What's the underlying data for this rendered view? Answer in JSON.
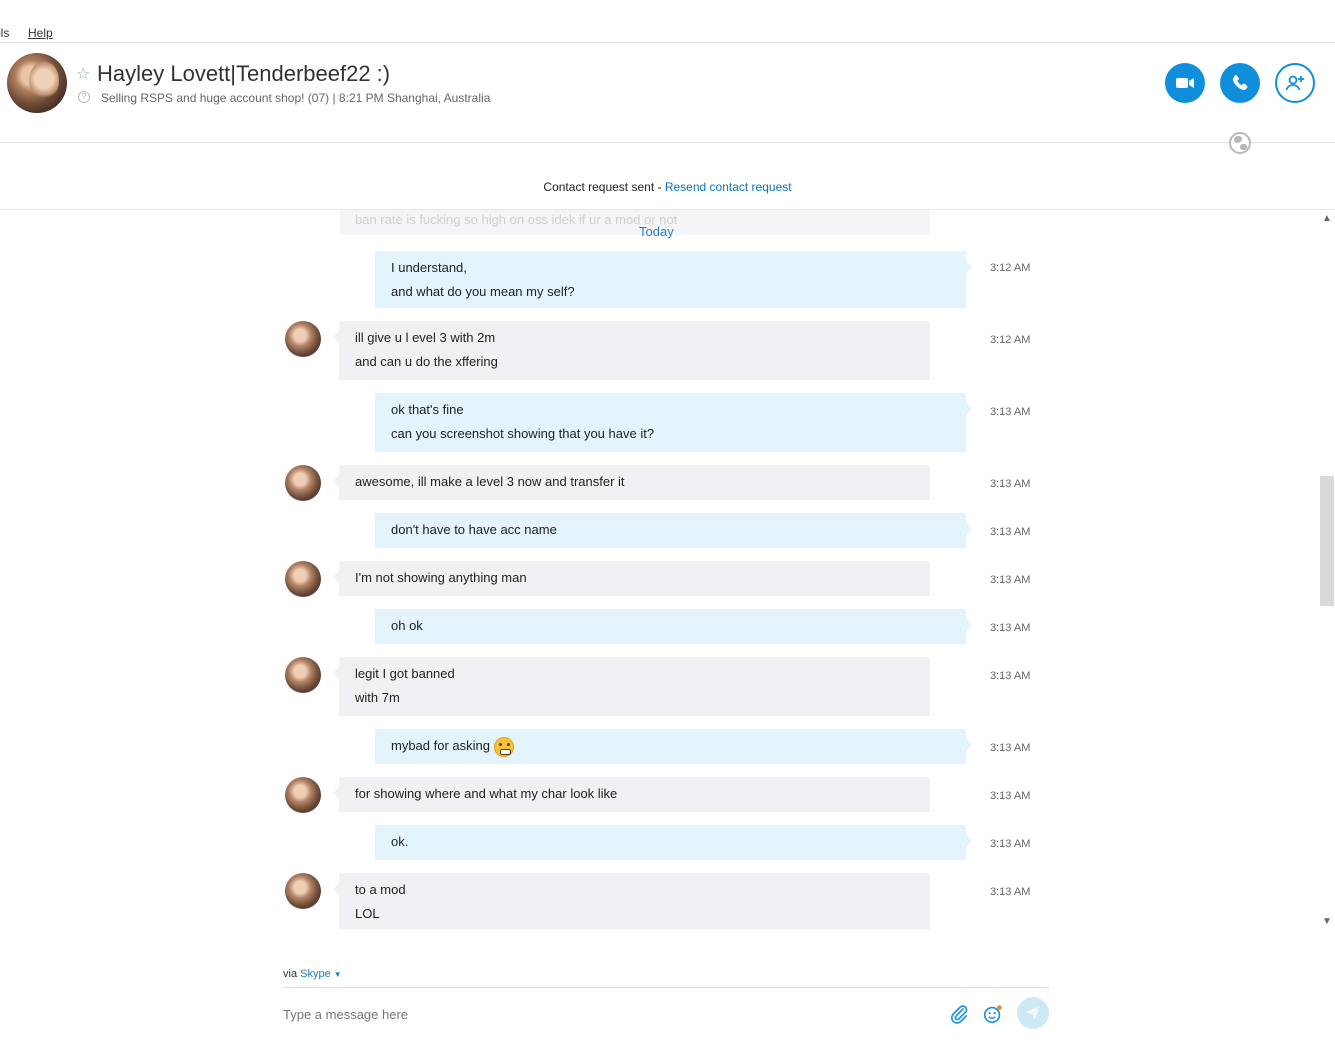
{
  "menu": {
    "tools_label": "ols",
    "help_label": "Help"
  },
  "header": {
    "contact_name": "Hayley Lovett|Tenderbeef22 :)",
    "mood_message": "Selling RSPS and huge account shop! (07)  |  8:21 PM Shanghai, Australia",
    "video_call_icon": "video-camera-icon",
    "audio_call_icon": "phone-icon",
    "add_people_icon": "add-person-icon"
  },
  "request_banner": {
    "text": "Contact request sent - ",
    "link": "Resend contact request"
  },
  "conversation": {
    "faded_message": "ban rate is fucking so high on oss idek if ur a mod or not",
    "date_divider": "Today",
    "messages": [
      {
        "from": "me",
        "lines": [
          "I understand,",
          "and what do you mean my self?"
        ],
        "time": "3:12 AM"
      },
      {
        "from": "them",
        "lines": [
          "ill give u l evel 3 with 2m",
          "and can u do the xffering"
        ],
        "time": "3:12 AM"
      },
      {
        "from": "me",
        "lines": [
          "ok that's fine",
          "can you screenshot showing that you have it?"
        ],
        "time": "3:13 AM"
      },
      {
        "from": "them",
        "lines": [
          "awesome, ill make a level 3 now and transfer it"
        ],
        "time": "3:13 AM"
      },
      {
        "from": "me",
        "lines": [
          "don't have to have acc name"
        ],
        "time": "3:13 AM"
      },
      {
        "from": "them",
        "lines": [
          "I'm not showing anything man"
        ],
        "time": "3:13 AM"
      },
      {
        "from": "me",
        "lines": [
          "oh ok"
        ],
        "time": "3:13 AM"
      },
      {
        "from": "them",
        "lines": [
          "legit I got banned",
          "with 7m"
        ],
        "time": "3:13 AM"
      },
      {
        "from": "me",
        "lines": [
          "mybad for asking"
        ],
        "emoji": "grimace-emoji",
        "time": "3:13 AM"
      },
      {
        "from": "them",
        "lines": [
          "for showing where and what my char look like"
        ],
        "time": "3:13 AM"
      },
      {
        "from": "me",
        "lines": [
          "ok."
        ],
        "time": "3:13 AM"
      },
      {
        "from": "them",
        "lines": [
          "to a mod",
          "LOL"
        ],
        "time": "3:13 AM"
      }
    ]
  },
  "compose": {
    "via_label": "via ",
    "via_service": "Skype",
    "placeholder": "Type a message here",
    "attach_icon": "paperclip-icon",
    "emoticon_icon": "emoticon-icon",
    "send_icon": "send-icon"
  },
  "colors": {
    "accent": "#0f8fdb",
    "my_bubble": "#e3f4fc",
    "their_bubble": "#eff1f4",
    "link": "#0f72b8"
  }
}
